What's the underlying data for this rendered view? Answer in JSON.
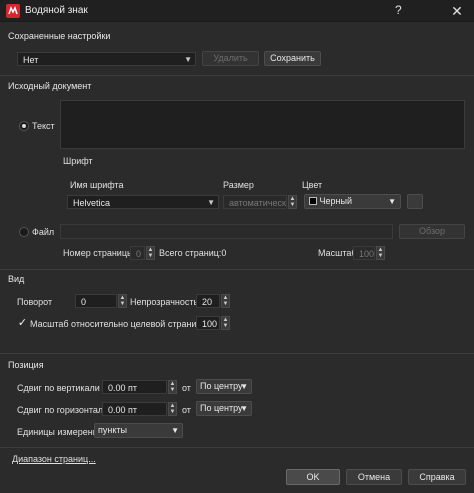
{
  "window": {
    "title": "Водяной знак",
    "help_label": "?",
    "close_label": "✕"
  },
  "saved": {
    "section": "Сохраненные настройки",
    "preset_value": "Нет",
    "delete_label": "Удалить",
    "save_label": "Сохранить"
  },
  "source": {
    "section": "Исходный документ",
    "text_option": "Текст",
    "font_group": "Шрифт",
    "font_name_label": "Имя шрифта",
    "font_name_value": "Helvetica",
    "size_label": "Размер",
    "size_value": "автоматически",
    "color_label": "Цвет",
    "color_value": "Черный",
    "file_option": "Файл",
    "browse_label": "Обзор",
    "page_number_label": "Номер страницы",
    "page_number_value": "0",
    "total_pages_label": "Всего страниц:0",
    "scale_label": "Масштаб",
    "scale_value": "100"
  },
  "view": {
    "section": "Вид",
    "rotation_label": "Поворот",
    "rotation_value": "0",
    "opacity_label": "Непрозрачность",
    "opacity_value": "20",
    "relative_scale_checked": true,
    "relative_scale_label": "Масштаб относительно целевой страницы",
    "relative_scale_value": "100"
  },
  "position": {
    "section": "Позиция",
    "vertical_label": "Сдвиг по вертикали",
    "vertical_value": "0.00 пт",
    "vertical_from": "от",
    "vertical_anchor": "По центру",
    "horizontal_label": "Сдвиг по горизонтали",
    "horizontal_value": "0.00 пт",
    "horizontal_from": "от",
    "horizontal_anchor": "По центру",
    "units_label": "Единицы измерения",
    "units_value": "пункты"
  },
  "footer": {
    "page_range_link": "Диапазон страниц...",
    "ok_label": "OK",
    "cancel_label": "Отмена",
    "help_label": "Справка"
  },
  "colors": {
    "app_icon": "#d7262d",
    "swatch": "#000000"
  }
}
